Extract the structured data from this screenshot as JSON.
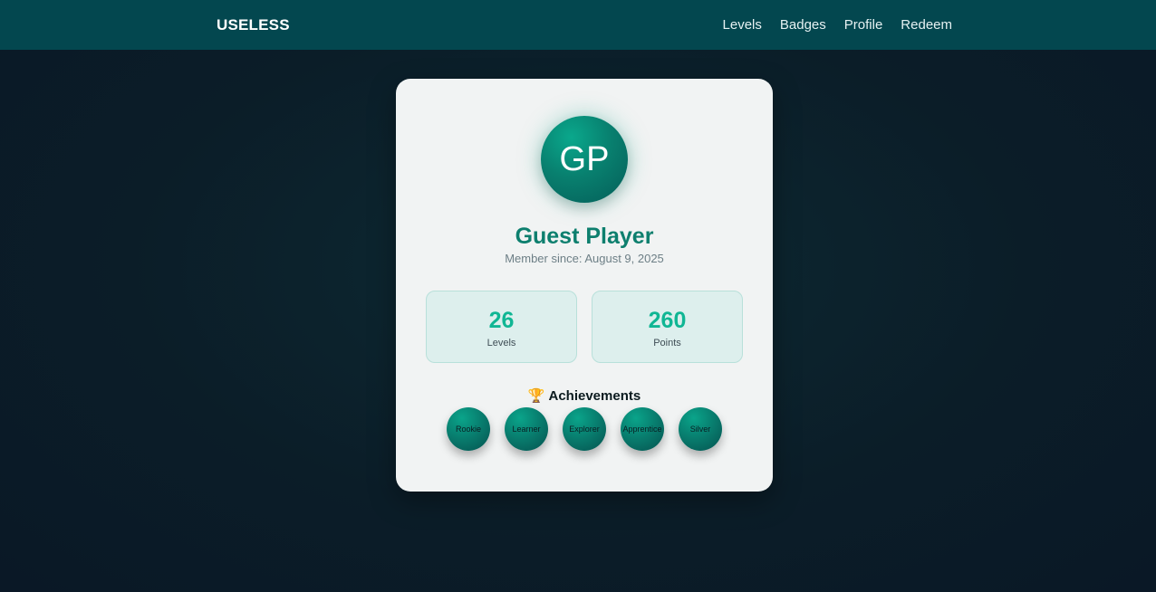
{
  "header": {
    "brand": "USELESS",
    "nav": [
      "Levels",
      "Badges",
      "Profile",
      "Redeem"
    ]
  },
  "profile": {
    "initials": "GP",
    "name": "Guest Player",
    "member_since": "Member since: August 9, 2025"
  },
  "stats": {
    "levels": {
      "value": "26",
      "label": "Levels"
    },
    "points": {
      "value": "260",
      "label": "Points"
    }
  },
  "achievements": {
    "icon": "🏆",
    "title": "Achievements",
    "badges": [
      "Rookie",
      "Learner",
      "Explorer",
      "Apprentice",
      "Silver"
    ]
  },
  "colors": {
    "header_bg": "#03474f",
    "accent": "#0d7f6e",
    "stat_number": "#10b694",
    "card_bg": "#f1f3f3"
  }
}
